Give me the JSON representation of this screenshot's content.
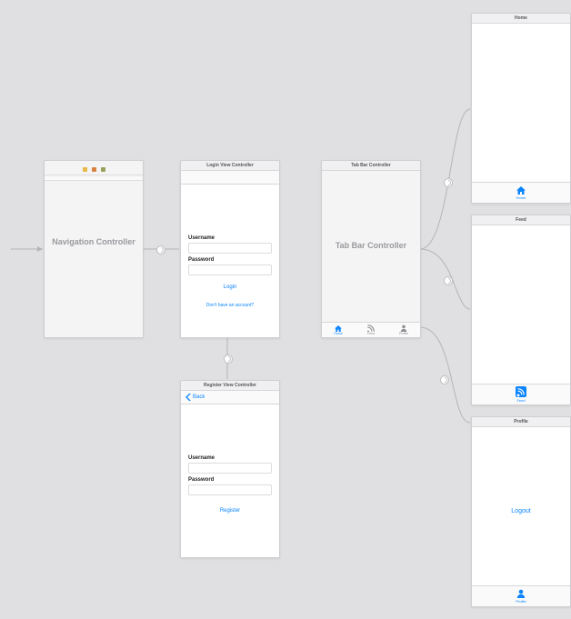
{
  "entry_arrow": true,
  "nav_controller": {
    "title": "Navigation Controller",
    "dot_colors": [
      "#e8b84a",
      "#d98140",
      "#9aa05a"
    ]
  },
  "login_vc": {
    "titlebar": "Login View Controller",
    "username_label": "Username",
    "password_label": "Password",
    "login_button": "Login",
    "register_prompt": "Don't have an account?"
  },
  "register_vc": {
    "titlebar": "Register View Controller",
    "back_label": "Back",
    "username_label": "Username",
    "password_label": "Password",
    "register_button": "Register"
  },
  "tabbar_controller": {
    "titlebar": "Tab Bar Controller",
    "body_label": "Tab Bar Controller",
    "tabs": [
      {
        "label": "Home"
      },
      {
        "label": "Feed"
      },
      {
        "label": "Profile"
      }
    ]
  },
  "home_vc": {
    "titlebar": "Home",
    "bottom_label": "Home"
  },
  "feed_vc": {
    "titlebar": "Feed",
    "bottom_label": "Feed"
  },
  "profile_vc": {
    "titlebar": "Profile",
    "logout_button": "Logout",
    "bottom_label": "Profile"
  }
}
